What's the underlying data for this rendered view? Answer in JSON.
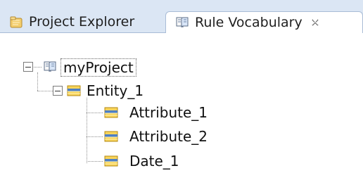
{
  "tabs": [
    {
      "label": "Project Explorer",
      "icon": "project-explorer-icon",
      "active": false
    },
    {
      "label": "Rule Vocabulary",
      "icon": "rule-vocabulary-icon",
      "active": true,
      "close_icon": "close-icon"
    }
  ],
  "tree": {
    "root": {
      "label": "myProject",
      "icon": "project-book-icon",
      "expanded": true
    },
    "children": [
      {
        "label": "Entity_1",
        "icon": "entity-icon",
        "expanded": true
      },
      {
        "label": "Attribute_1",
        "icon": "attribute-icon"
      },
      {
        "label": "Attribute_2",
        "icon": "attribute-icon"
      },
      {
        "label": "Date_1",
        "icon": "attribute-icon"
      }
    ]
  }
}
